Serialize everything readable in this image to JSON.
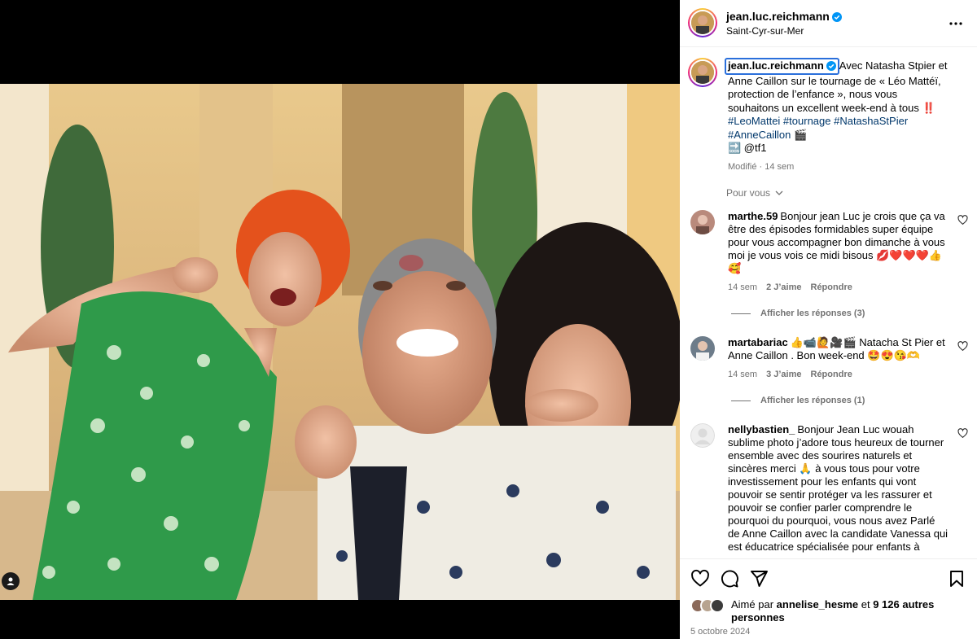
{
  "post": {
    "author": "jean.luc.reichmann",
    "location": "Saint-Cyr-sur-Mer",
    "caption_lines": [
      "Avec Natasha Stpier et",
      "Anne Caillon sur le tournage de « Léo Mattéï,",
      "protection de l’enfance », nous vous",
      "souhaitons un excellent week-end à tous ‼️"
    ],
    "hashtags_line1": "#LeoMattei #tournage #NatashaStPier",
    "hashtags_line2": "#AnneCaillon 🎬",
    "mention": "🔜 @tf1",
    "modified": "Modifié · 14 sem",
    "for_you": "Pour vous",
    "likes_prefix": "Aimé par",
    "likes_user": "annelise_hesme",
    "likes_mid": "et",
    "likes_count": "9 126 autres personnes",
    "date": "5 octobre 2024"
  },
  "comments": [
    {
      "user": "marthe.59",
      "text": "Bonjour jean Luc je crois que ça va être des épisodes formidables super équipe pour vous accompagner bon dimanche à vous moi je vous vois ce midi bisous 💋❤️❤️❤️👍🥰",
      "time": "14 sem",
      "likes": "2 J’aime",
      "reply": "Répondre",
      "view_replies": "Afficher les réponses (3)",
      "avatar_color": "#b98a7c"
    },
    {
      "user": "martabariac",
      "text": "👍📹🙋🎥🎬 Natacha St Pier et Anne Caillon . Bon week-end 🤩😍😘🫶",
      "time": "14 sem",
      "likes": "3 J’aime",
      "reply": "Répondre",
      "view_replies": "Afficher les réponses (1)",
      "avatar_color": "#6d7c8a"
    },
    {
      "user": "nellybastien_",
      "text": "Bonjour Jean Luc wouah sublime photo j’adore tous heureux de tourner ensemble avec des sourires naturels et sincères merci 🙏 à vous tous pour votre investissement pour les enfants qui vont pouvoir se sentir protéger va les rassurer et pouvoir se confier parler comprendre le pourquoi du pourquoi, vous nous avez Parlé de Anne Caillon avec la candidate Vanessa qui est éducatrice spécialisée pour enfants à",
      "avatar_color": "#dbdbdb"
    }
  ],
  "icons": {
    "more": "more-horizontal-icon",
    "like": "heart-icon",
    "comment": "comment-icon",
    "share": "paper-plane-icon",
    "save": "bookmark-icon",
    "verified": "verified-badge-icon",
    "user_tag": "user-tag-icon"
  },
  "colors": {
    "verified": "#0095f6",
    "hashtag": "#00376b",
    "secondary_text": "#737373"
  }
}
